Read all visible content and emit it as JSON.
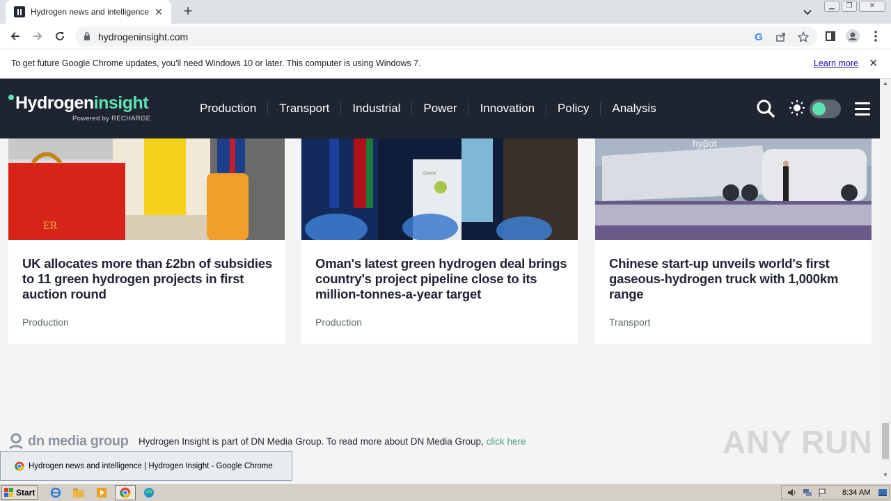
{
  "browser": {
    "tab_title": "Hydrogen news and intelligence | Hy",
    "url": "hydrogeninsight.com",
    "window_controls": [
      "minimize",
      "restore",
      "close"
    ]
  },
  "infobar": {
    "message": "To get future Google Chrome updates, you'll need Windows 10 or later. This computer is using Windows 7.",
    "learn_more": "Learn more"
  },
  "site": {
    "logo_prefix": "Hydrogen",
    "logo_accent": "insight",
    "logo_tagline": "Powered by RECHARGE",
    "nav": [
      "Production",
      "Transport",
      "Industrial",
      "Power",
      "Innovation",
      "Policy",
      "Analysis"
    ],
    "accent_color": "#5ee2b0",
    "header_color": "#1e2430"
  },
  "articles": [
    {
      "title": "UK allocates more than £2bn of subsidies to 11 green hydrogen projects in first auction round",
      "category": "Production"
    },
    {
      "title": "Oman's latest green hydrogen deal brings country's project pipeline close to its million-tonnes-a-year target",
      "category": "Production"
    },
    {
      "title": "Chinese start-up unveils world's first gaseous-hydrogen truck with 1,000km range",
      "category": "Transport"
    }
  ],
  "footer": {
    "group_logo": "dn media group",
    "text": "Hydrogen Insight is part of DN Media Group. To read more about DN Media Group,",
    "link": "click here"
  },
  "watermark": "ANY RUN",
  "taskbar": {
    "start": "Start",
    "popup_title": "Hydrogen news and intelligence | Hydrogen Insight - Google Chrome",
    "clock": "8:34 AM"
  }
}
